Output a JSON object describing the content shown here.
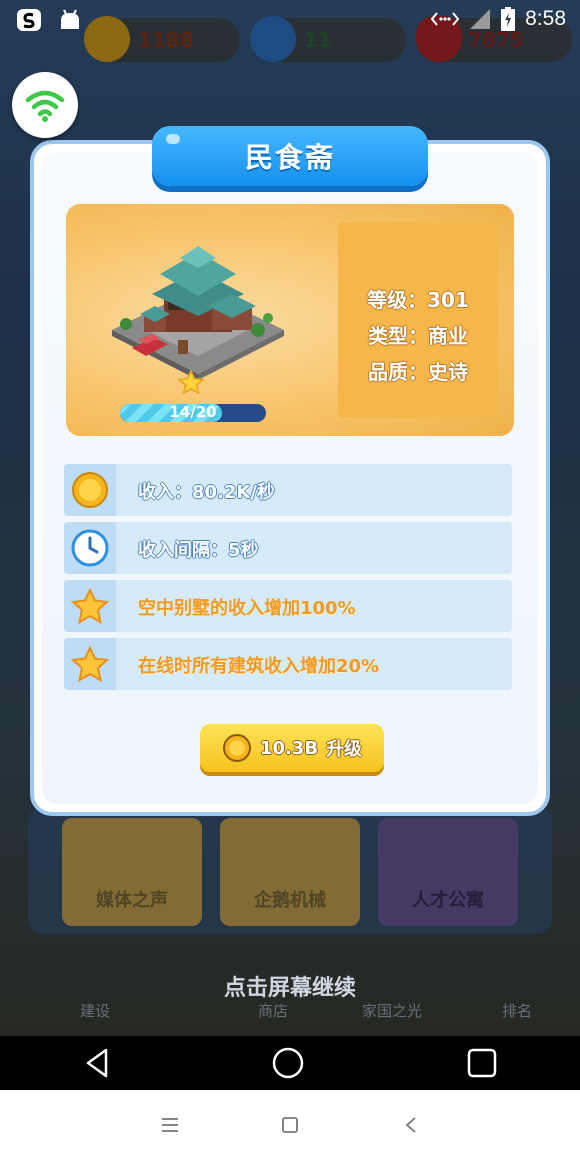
{
  "status_bar": {
    "time": "8:58",
    "icons": [
      "app-s-icon",
      "android-icon",
      "data-arrows-icon",
      "signal-icon",
      "battery-icon"
    ]
  },
  "resources": {
    "coins": "1188",
    "gems": "11",
    "hearts": "7875"
  },
  "dialog": {
    "title": "民食斋",
    "level_line": "等级：301",
    "type_line": "类型：商业",
    "quality_line": "品质：史诗",
    "progress_text": "14/20",
    "progress_fraction": 0.7,
    "rows": [
      {
        "icon": "coin-icon",
        "text": "收入：80.2K/秒",
        "style": "blue"
      },
      {
        "icon": "clock-icon",
        "text": "收入间隔：5秒",
        "style": "blue"
      },
      {
        "icon": "star-icon",
        "text": "空中别墅的收入增加100%",
        "style": "orange"
      },
      {
        "icon": "star-icon",
        "text": "在线时所有建筑收入增加20%",
        "style": "orange"
      }
    ],
    "upgrade_cost": "10.3B",
    "upgrade_label": "升级"
  },
  "background": {
    "cards": [
      "媒体之声",
      "企鹅机械",
      "人才公寓"
    ],
    "continue_hint": "点击屏幕继续",
    "tabs": [
      "建设",
      "商店",
      "家国之光",
      "排名"
    ]
  },
  "colors": {
    "title_banner": "#1e9bf5",
    "panel": "#f6c061",
    "row_bg": "#d6ebfa",
    "button": "#f8cc2a"
  }
}
